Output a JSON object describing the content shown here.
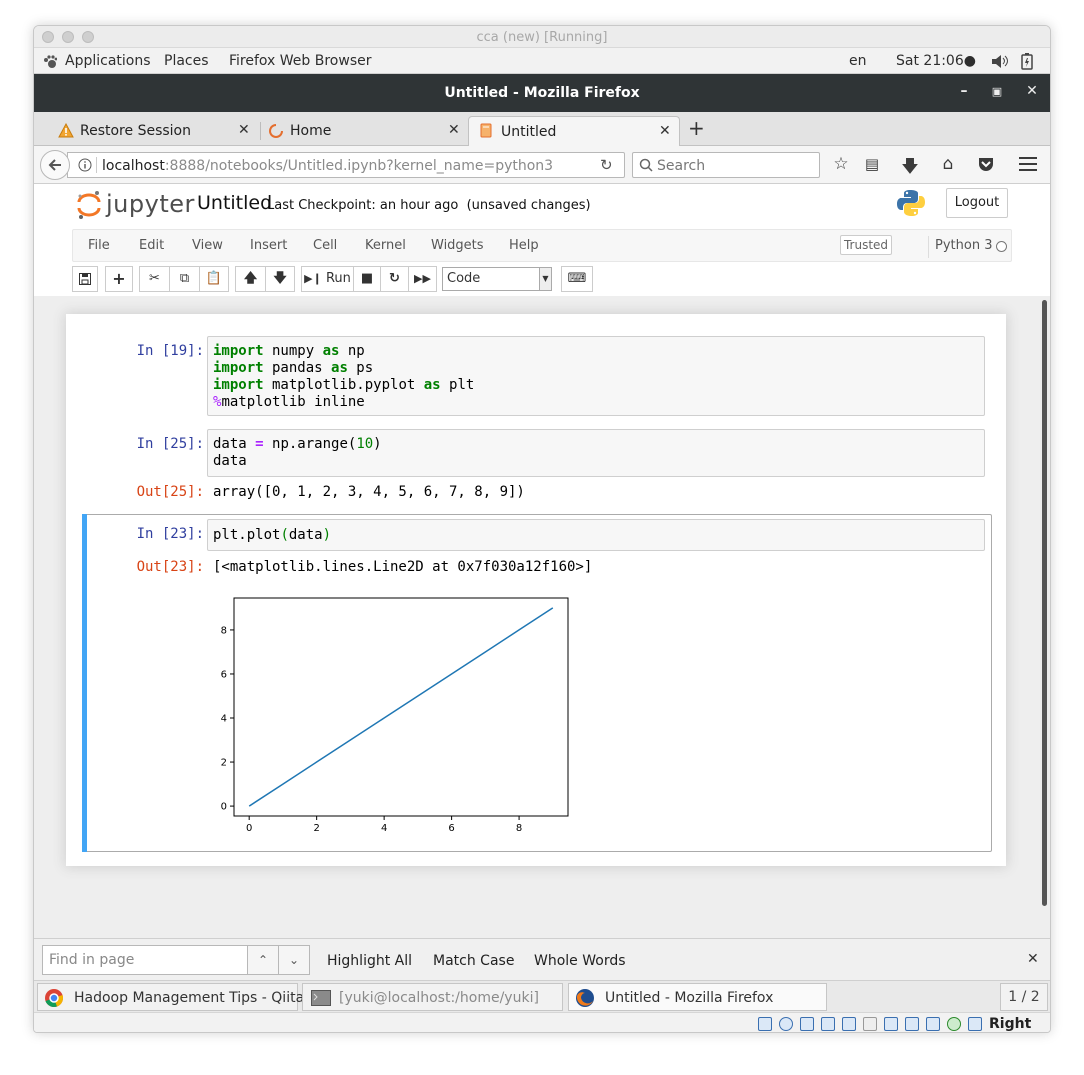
{
  "vm": {
    "title": "cca (new) [Running]"
  },
  "gnome": {
    "applications": "Applications",
    "places": "Places",
    "app_name": "Firefox Web Browser",
    "lang": "en",
    "clock": "Sat 21:06●"
  },
  "firefox": {
    "window_title": "Untitled - Mozilla Firefox",
    "tabs": [
      {
        "label": "Restore Session"
      },
      {
        "label": "Home"
      },
      {
        "label": "Untitled"
      }
    ],
    "url_host": "localhost",
    "url_rest": ":8888/notebooks/Untitled.ipynb?kernel_name=python3",
    "search_placeholder": "Search"
  },
  "jupyter": {
    "logo_text": "jupyter",
    "notebook_name": "Untitled",
    "checkpoint": "Last Checkpoint: an hour ago",
    "unsaved": "(unsaved changes)",
    "logout": "Logout",
    "menu": [
      "File",
      "Edit",
      "View",
      "Insert",
      "Cell",
      "Kernel",
      "Widgets",
      "Help"
    ],
    "trusted": "Trusted",
    "kernel": "Python 3",
    "toolbar": {
      "run": "Run",
      "cell_type": "Code"
    }
  },
  "cells": [
    {
      "prompt": "In [19]:"
    },
    {
      "prompt": "In [25]:",
      "out_prompt": "Out[25]:",
      "output": "array([0, 1, 2, 3, 4, 5, 6, 7, 8, 9])"
    },
    {
      "prompt": "In [23]:",
      "out_prompt": "Out[23]:",
      "output": "[<matplotlib.lines.Line2D at 0x7f030a12f160>]"
    }
  ],
  "chart_data": {
    "type": "line",
    "x": [
      0,
      1,
      2,
      3,
      4,
      5,
      6,
      7,
      8,
      9
    ],
    "series": [
      {
        "values": [
          0,
          1,
          2,
          3,
          4,
          5,
          6,
          7,
          8,
          9
        ],
        "color": "#1f77b4"
      }
    ],
    "xticks": [
      0,
      2,
      4,
      6,
      8
    ],
    "yticks": [
      0,
      2,
      4,
      6,
      8
    ],
    "xlim": [
      -0.45,
      9.45
    ],
    "ylim": [
      -0.45,
      9.45
    ],
    "grid": false
  },
  "findbar": {
    "placeholder": "Find in page",
    "highlight_all": "Highlight All",
    "match_case": "Match Case",
    "whole_words": "Whole Words"
  },
  "taskbar": {
    "items": [
      {
        "label": "Hadoop Management Tips - Qiita - ..."
      },
      {
        "label": "[yuki@localhost:/home/yuki]"
      },
      {
        "label": "Untitled - Mozilla Firefox"
      }
    ],
    "pager": "1 / 2"
  },
  "vbox": {
    "host_key": "Right ⌥"
  }
}
